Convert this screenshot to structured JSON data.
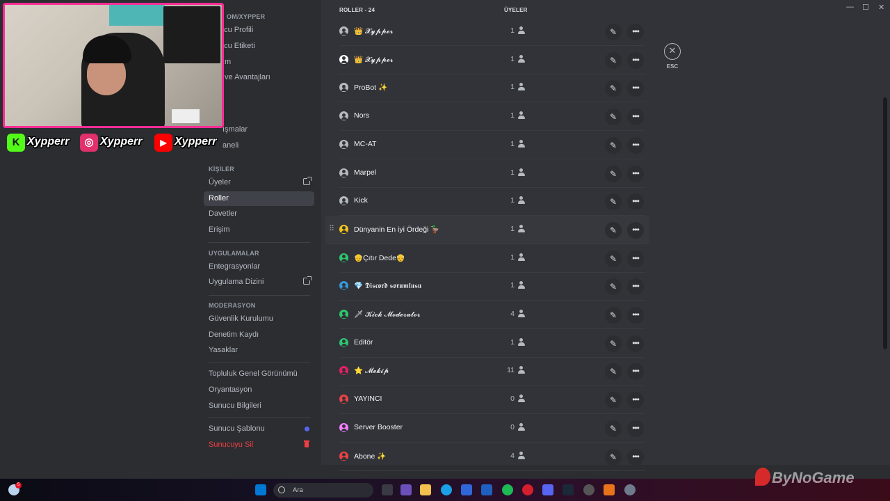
{
  "window": {
    "minimize": "—",
    "maximize": "☐",
    "close": "✕"
  },
  "sidebar": {
    "server_header": "OM/XYPPER",
    "top_items": [
      {
        "label": "ucu Profili"
      },
      {
        "label": "ucu Etiketi"
      },
      {
        "label": "m"
      },
      {
        "label": "ve Avantajları"
      },
      {
        "label": "ışmalar"
      },
      {
        "label": "aneli"
      }
    ],
    "sections": {
      "people": {
        "header": "KİŞİLER",
        "items": [
          {
            "label": "Üyeler"
          },
          {
            "label": "Roller"
          },
          {
            "label": "Davetler"
          },
          {
            "label": "Erişim"
          }
        ]
      },
      "apps": {
        "header": "UYGULAMALAR",
        "items": [
          {
            "label": "Entegrasyonlar"
          },
          {
            "label": "Uygulama Dizini"
          }
        ]
      },
      "moderation": {
        "header": "MODERASYON",
        "items": [
          {
            "label": "Güvenlik Kurulumu"
          },
          {
            "label": "Denetim Kaydı"
          },
          {
            "label": "Yasaklar"
          }
        ]
      },
      "misc": {
        "items": [
          {
            "label": "Topluluk Genel Görünümü"
          },
          {
            "label": "Oryantasyon"
          },
          {
            "label": "Sunucu Bilgileri"
          }
        ]
      },
      "danger": {
        "items": [
          {
            "label": "Sunucu Şablonu"
          },
          {
            "label": "Sunucuyu Sil"
          }
        ]
      }
    }
  },
  "roles_table": {
    "header_roles": "ROLLER - 24",
    "header_members": "ÜYELER",
    "rows": [
      {
        "name": "👑 𝓧𝔂𝓹𝓹𝓮𝓻",
        "count": "1",
        "color": "#b5bac1",
        "fancy": false
      },
      {
        "name": "👑 𝓧𝔂𝓹𝓹𝓮𝓻",
        "count": "1",
        "color": "#ffffff",
        "fancy": false
      },
      {
        "name": "ProBot ✨",
        "count": "1",
        "color": "#b5bac1",
        "fancy": false
      },
      {
        "name": "Nors",
        "count": "1",
        "color": "#b5bac1",
        "fancy": false
      },
      {
        "name": "MC-AT",
        "count": "1",
        "color": "#b5bac1",
        "fancy": false
      },
      {
        "name": "Marpel",
        "count": "1",
        "color": "#b5bac1",
        "fancy": false
      },
      {
        "name": "Kick",
        "count": "1",
        "color": "#b5bac1",
        "fancy": false
      },
      {
        "name": "Dünyanin En iyi Ördeği 🦆",
        "count": "1",
        "color": "#f0c419",
        "fancy": false
      },
      {
        "name": "👴Çıtır Dede👴",
        "count": "1",
        "color": "#2dc770",
        "fancy": false
      },
      {
        "name": "💎 𝕯𝖎𝖘𝖈𝖔𝖗𝖉 𝖘𝖔𝖗𝖚𝖒𝖑𝖚𝖘𝖚",
        "count": "1",
        "color": "#3498db",
        "fancy": false
      },
      {
        "name": "🗡 𝓚𝓲𝓬𝓴 𝓜𝓸𝓭𝓮𝓻𝓪𝓽𝓸𝓻",
        "count": "4",
        "color": "#2dc770",
        "fancy": false
      },
      {
        "name": "Editör",
        "count": "1",
        "color": "#2dc770",
        "fancy": false
      },
      {
        "name": "⭐ 𝓜𝓮𝓴𝓲𝓹",
        "count": "11",
        "color": "#e91e63",
        "fancy": false
      },
      {
        "name": "YAYINCI",
        "count": "0",
        "color": "#ed4245",
        "fancy": false
      },
      {
        "name": "Server Booster",
        "count": "0",
        "color": "#f47fff",
        "fancy": false
      },
      {
        "name": "Abone ✨",
        "count": "4",
        "color": "#ed4245",
        "fancy": false
      }
    ]
  },
  "close": {
    "label": "ESC",
    "icon": "close-icon"
  },
  "overlay": {
    "socials": [
      {
        "icon": "kick-icon",
        "glyph": "K",
        "color": "#53fc18",
        "handle": "Xypperr"
      },
      {
        "icon": "instagram-icon",
        "glyph": "◎",
        "color": "#e1306c",
        "handle": "Xypperr"
      },
      {
        "icon": "youtube-icon",
        "glyph": "▶",
        "color": "#ff0000",
        "handle": "Xypperr"
      }
    ]
  },
  "taskbar": {
    "search_placeholder": "Ara",
    "weather_badge": "5",
    "watermark": "ByNoGame"
  }
}
